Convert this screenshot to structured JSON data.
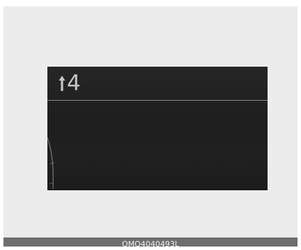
{
  "display": {
    "shift_indicator": {
      "icon": "up-arrow-icon",
      "gear": "4"
    }
  },
  "caption": {
    "code": "OMQ4040493L"
  },
  "colors": {
    "display_background": "#1f1f1f",
    "gear_text": "#c6c6c6",
    "divider": "#8a8a8a",
    "frame_background": "#ececec",
    "caption_bar": "#6e6e6e"
  }
}
